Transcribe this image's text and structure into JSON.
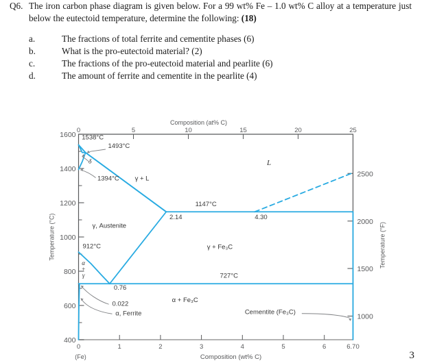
{
  "question": {
    "number": "Q6.",
    "text": "The iron carbon phase diagram is given below. For a 99 wt% Fe – 1.0 wt% C alloy at a temperature just below the eutectoid temperature, determine the following: ",
    "marks": "(18)",
    "sub_questions": [
      {
        "letter": "a.",
        "text": "The fractions of total ferrite and cementite phases (6)"
      },
      {
        "letter": "b.",
        "text": "What is the pro-eutectoid material? (2)"
      },
      {
        "letter": "c.",
        "text": "The fractions of the pro-eutectoid material and pearlite (6)"
      },
      {
        "letter": "d.",
        "text": "The amount of ferrite and cementite in the pearlite (4)"
      }
    ]
  },
  "page_number": "3",
  "chart_data": {
    "type": "line",
    "title": "",
    "subtitle": "",
    "xlabel": "Composition (wt% C)",
    "ylabel": "Temperature (°C)",
    "xlabel_top": "Composition (at% C)",
    "ylabel_right": "Temperature (°F)",
    "xlim": [
      0,
      6.7
    ],
    "ylim": [
      400,
      1600
    ],
    "grid": false,
    "legend": "none",
    "x_origin_note": "(Fe)",
    "x_ticks_bottom": [
      "0",
      "1",
      "2",
      "3",
      "4",
      "5",
      "6",
      "6.70"
    ],
    "x_tick_values_bottom": [
      0,
      1,
      2,
      3,
      4,
      5,
      6,
      6.7
    ],
    "x_ticks_top": [
      "0",
      "5",
      "10",
      "15",
      "20",
      "25"
    ],
    "x_tick_at_pct": [
      0,
      5,
      10,
      15,
      20,
      25
    ],
    "y_ticks_left": [
      "1600",
      "1400",
      "1200",
      "1000",
      "800",
      "600",
      "400"
    ],
    "y_tick_values_left": [
      1600,
      1400,
      1200,
      1000,
      800,
      600,
      400
    ],
    "y_minor_left": [
      1500,
      1300,
      1100,
      900,
      700,
      500
    ],
    "y_ticks_right": [
      "2500",
      "2000",
      "1500",
      "1000"
    ],
    "y_tick_values_right_c": [
      1371,
      1093,
      816,
      538
    ],
    "phase_regions": [
      {
        "id": "liquid",
        "label": "L",
        "x": 4.65,
        "y": 1420
      },
      {
        "id": "gamma-liquid",
        "label": "γ + L",
        "x": 1.55,
        "y": 1330
      },
      {
        "id": "austenite",
        "label": "γ, Austenite",
        "x": 0.75,
        "y": 1055
      },
      {
        "id": "gamma-fe3c",
        "label": "γ + Fe₃C",
        "x": 3.45,
        "y": 930
      },
      {
        "id": "alpha-fe3c",
        "label": "α + Fe₃C",
        "x": 2.6,
        "y": 620
      },
      {
        "id": "alpha-gamma",
        "label": "α + γ",
        "x": 0.12,
        "y": 800
      },
      {
        "id": "delta",
        "label": "δ",
        "x": 0.28,
        "y": 1430
      }
    ],
    "annotations": [
      {
        "id": "melting-point-fe",
        "label": "1538°C",
        "x": 0.08,
        "y": 1570
      },
      {
        "id": "peritectic-temp",
        "label": "1493°C",
        "x": 0.72,
        "y": 1520
      },
      {
        "id": "delta-gamma-temp",
        "label": "1394°C",
        "x": 0.46,
        "y": 1330
      },
      {
        "id": "gamma-alpha-temp",
        "label": "912°C",
        "x": 0.1,
        "y": 935
      },
      {
        "id": "eutectic-temp",
        "label": "1147°C",
        "x": 2.85,
        "y": 1180
      },
      {
        "id": "eutectoid-temp",
        "label": "727°C",
        "x": 3.45,
        "y": 762
      },
      {
        "id": "eutectoid-comp",
        "label": "0.76",
        "x": 0.86,
        "y": 692
      },
      {
        "id": "max-ferrite-solubility",
        "label": "0.022",
        "x": 0.82,
        "y": 598
      },
      {
        "id": "ferrite-label",
        "label": "α, Ferrite",
        "x": 0.9,
        "y": 542
      },
      {
        "id": "eutectic-comp",
        "label": "4.30",
        "x": 4.3,
        "y": 1105
      },
      {
        "id": "austenite-max-c",
        "label": "2.14",
        "x": 2.22,
        "y": 1105
      },
      {
        "id": "cementite-label",
        "label": "Cementite (Fe₃C)",
        "x": 5.3,
        "y": 550
      }
    ],
    "key_points": {
      "eutectoid": {
        "composition": 0.76,
        "temperature": 727
      },
      "eutectic": {
        "composition": 4.3,
        "temperature": 1147
      },
      "peritectic": {
        "composition": 0.17,
        "temperature": 1493
      },
      "max_c_in_austenite": {
        "composition": 2.14,
        "temperature": 1147
      },
      "max_c_in_ferrite": {
        "composition": 0.022,
        "temperature": 727
      },
      "fe_melting": {
        "composition": 0,
        "temperature": 1538
      },
      "delta_to_gamma": {
        "composition": 0,
        "temperature": 1394
      },
      "gamma_to_alpha": {
        "composition": 0,
        "temperature": 912
      },
      "cementite": {
        "composition": 6.7
      }
    },
    "series": [
      {
        "name": "liquidus-left",
        "points": [
          [
            0,
            1538
          ],
          [
            0.17,
            1493
          ],
          [
            0.53,
            1430
          ],
          [
            2.14,
            1147
          ]
        ]
      },
      {
        "name": "liquidus-right",
        "points": [
          [
            4.3,
            1147
          ],
          [
            6.7,
            1375
          ]
        ],
        "dashed": true
      },
      {
        "name": "solidus-gamma",
        "points": [
          [
            0.17,
            1493
          ],
          [
            2.14,
            1147
          ]
        ]
      },
      {
        "name": "delta-solvus",
        "points": [
          [
            0,
            1538
          ],
          [
            0.09,
            1493
          ],
          [
            0.17,
            1493
          ]
        ]
      },
      {
        "name": "delta-gamma-boundary",
        "points": [
          [
            0.17,
            1493
          ],
          [
            0.09,
            1440
          ],
          [
            0,
            1394
          ]
        ]
      },
      {
        "name": "gamma-solvus-A3",
        "points": [
          [
            0,
            912
          ],
          [
            0.3,
            845
          ],
          [
            0.55,
            780
          ],
          [
            0.76,
            727
          ]
        ]
      },
      {
        "name": "acm-line",
        "points": [
          [
            0.76,
            727
          ],
          [
            2.14,
            1147
          ]
        ]
      },
      {
        "name": "eutectic-isotherm",
        "points": [
          [
            2.14,
            1147
          ],
          [
            6.7,
            1147
          ]
        ]
      },
      {
        "name": "eutectoid-isotherm",
        "points": [
          [
            0.022,
            727
          ],
          [
            6.7,
            727
          ]
        ]
      },
      {
        "name": "alpha-solvus",
        "points": [
          [
            0,
            727
          ],
          [
            0.022,
            727
          ],
          [
            0.008,
            600
          ],
          [
            0,
            400
          ]
        ]
      },
      {
        "name": "cementite-line",
        "points": [
          [
            6.7,
            1147
          ],
          [
            6.7,
            400
          ]
        ]
      }
    ],
    "colors": {
      "curve": "#29abe2",
      "axis": "#58595b",
      "text": "#58595b",
      "leader": "#808285"
    }
  }
}
